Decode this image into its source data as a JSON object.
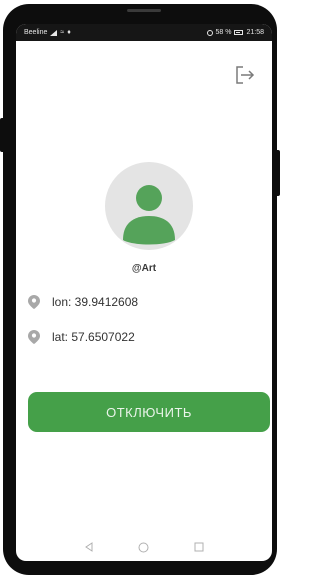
{
  "status_bar": {
    "carrier": "Beeline",
    "battery": "58 %",
    "time": "21:58"
  },
  "icons": {
    "logout": "logout-icon",
    "avatar": "person-avatar-icon",
    "location": "location-pin-icon",
    "nav_back": "nav-back-icon",
    "nav_home": "nav-home-icon",
    "nav_recents": "nav-recents-icon"
  },
  "profile": {
    "username": "@Art"
  },
  "location": {
    "lon": "lon: 39.9412608",
    "lat": "lat: 57.6507022"
  },
  "actions": {
    "disconnect_label": "ОТКЛЮЧИТЬ"
  },
  "colors": {
    "accent": "#45a049",
    "avatar_bg": "#e4e4e4",
    "avatar_fg": "#55a35a"
  }
}
